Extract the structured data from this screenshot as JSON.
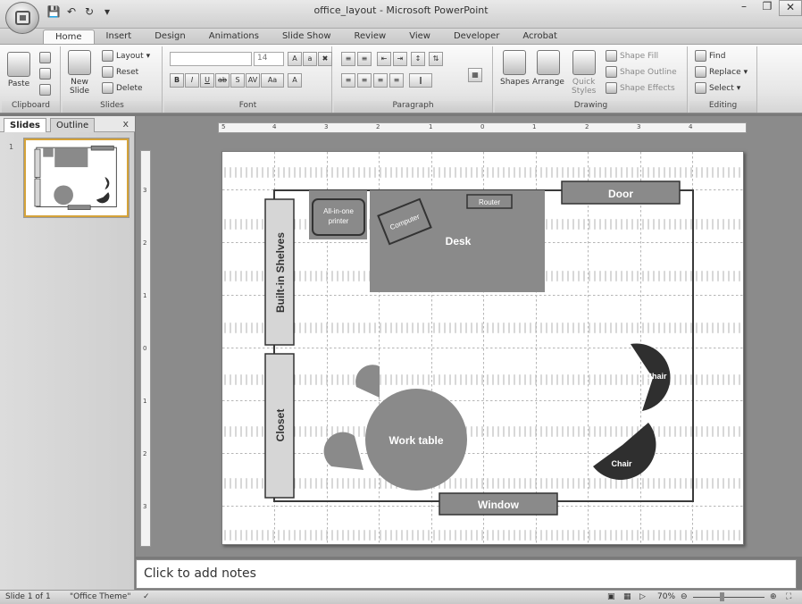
{
  "app": {
    "window_title": "office_layout - Microsoft PowerPoint",
    "close_tooltip": "Clos"
  },
  "tabs": [
    "Home",
    "Insert",
    "Design",
    "Animations",
    "Slide Show",
    "Review",
    "View",
    "Developer",
    "Acrobat"
  ],
  "ribbon": {
    "clipboard": {
      "label": "Clipboard",
      "paste": "Paste"
    },
    "slides": {
      "label": "Slides",
      "new_slide": "New\nSlide",
      "layout": "Layout",
      "reset": "Reset",
      "delete": "Delete"
    },
    "font": {
      "label": "Font",
      "size": "14"
    },
    "paragraph": {
      "label": "Paragraph"
    },
    "drawing": {
      "label": "Drawing",
      "shapes": "Shapes",
      "arrange": "Arrange",
      "quick_styles": "Quick\nStyles",
      "shape_fill": "Shape Fill",
      "shape_outline": "Shape Outline",
      "shape_effects": "Shape Effects"
    },
    "editing": {
      "label": "Editing",
      "find": "Find",
      "replace": "Replace",
      "select": "Select"
    }
  },
  "left_pane": {
    "tab_slides": "Slides",
    "tab_outline": "Outline",
    "close": "x",
    "slide_number": "1"
  },
  "rulers": {
    "horizontal": [
      "5",
      "4",
      "3",
      "2",
      "1",
      "0",
      "1",
      "2",
      "3",
      "4"
    ],
    "vertical": [
      "3",
      "2",
      "1",
      "0",
      "1",
      "2",
      "3"
    ]
  },
  "slide": {
    "door": "Door",
    "router": "Router",
    "desk": "Desk",
    "computer": "Computer",
    "printer": "All-in-one printer",
    "shelves": "Built-in Shelves",
    "closet": "Closet",
    "worktable": "Work table",
    "chair1": "Chair",
    "chair2": "Chair",
    "window": "Window"
  },
  "notes": {
    "placeholder": "Click to add notes"
  },
  "status": {
    "slide_of": "Slide 1 of 1",
    "theme": "\"Office Theme\"",
    "zoom": "70%"
  },
  "colors": {
    "shape_gray": "#8a8a8a",
    "dark_chair": "#2f2f2f",
    "light_panel": "#d6d6d6"
  }
}
